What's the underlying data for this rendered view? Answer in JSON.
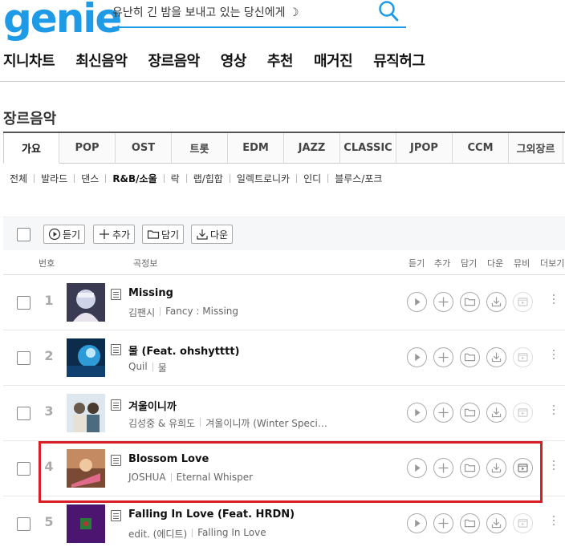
{
  "logo": {
    "text": "genie"
  },
  "search": {
    "placeholder": "유난히 긴 밤을 보내고 있는 당신에게 ☽"
  },
  "gnb": [
    "지니차트",
    "최신음악",
    "장르음악",
    "영상",
    "추천",
    "매거진",
    "뮤직허그"
  ],
  "page_title": "장르음악",
  "genre_tabs": [
    "가요",
    "POP",
    "OST",
    "트롯",
    "EDM",
    "JAZZ",
    "CLASSIC",
    "JPOP",
    "CCM",
    "그외장르"
  ],
  "active_tab": "가요",
  "subgenres": [
    "전체",
    "발라드",
    "댄스",
    "R&B/소울",
    "락",
    "랩/힙합",
    "일렉트로니카",
    "인디",
    "블루스/포크"
  ],
  "toolbar": {
    "listen": "듣기",
    "add": "추가",
    "save": "담기",
    "download": "다운"
  },
  "columns": {
    "num": "번호",
    "info": "곡정보",
    "listen": "듣기",
    "add": "추가",
    "save": "담기",
    "download": "다운",
    "mv": "뮤비",
    "more": "더보기"
  },
  "songs": [
    {
      "rank": "1",
      "title": "Missing",
      "artist": "김팬시",
      "album": "Fancy : Missing",
      "mv": false
    },
    {
      "rank": "2",
      "title": "물 (Feat. ohshytttt)",
      "artist": "Quil",
      "album": "물",
      "mv": false
    },
    {
      "rank": "3",
      "title": "겨울이니까",
      "artist": "김성중 & 유희도",
      "album": "겨울이니까 (Winter Speci…",
      "mv": false
    },
    {
      "rank": "4",
      "title": "Blossom Love",
      "artist": "JOSHUA",
      "album": "Eternal Whisper",
      "mv": true
    },
    {
      "rank": "5",
      "title": "Falling In Love (Feat. HRDN)",
      "artist": "edit. (에디트)",
      "album": "Falling In Love",
      "mv": false
    }
  ],
  "colors": {
    "brand": "#1e9ae6",
    "highlight": "#d81f26"
  }
}
